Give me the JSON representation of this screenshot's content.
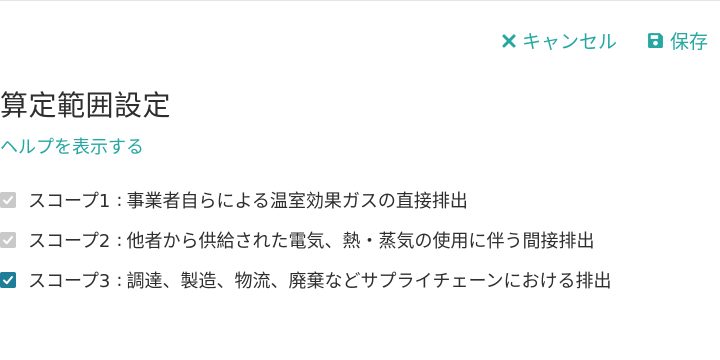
{
  "toolbar": {
    "cancel_label": "キャンセル",
    "save_label": "保存",
    "cancel_icon": "close-icon",
    "save_icon": "floppy-disk-icon"
  },
  "page": {
    "title": "算定範囲設定",
    "help_link": "ヘルプを表示する"
  },
  "scopes": [
    {
      "name": "スコープ1",
      "separator": ":",
      "description": "事業者自らによる温室効果ガスの直接排出",
      "checked": true,
      "enabled": false
    },
    {
      "name": "スコープ2",
      "separator": ":",
      "description": "他者から供給された電気、熱・蒸気の使用に伴う間接排出",
      "checked": true,
      "enabled": false
    },
    {
      "name": "スコープ3",
      "separator": ":",
      "description": "調達、製造、物流、廃棄などサプライチェーンにおける排出",
      "checked": true,
      "enabled": true
    }
  ],
  "colors": {
    "accent": "#26a7a1",
    "checkbox_active": "#1e7e9a",
    "checkbox_disabled": "#c9c9c9",
    "text": "#2e2e2e"
  }
}
